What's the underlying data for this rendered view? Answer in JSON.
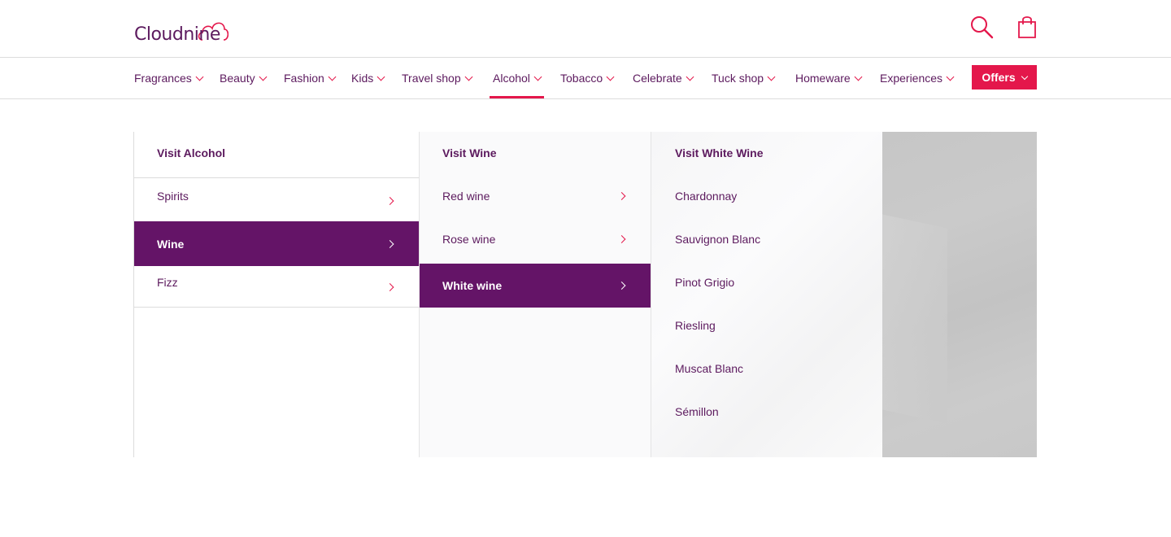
{
  "brand": {
    "name": "Cloudnine"
  },
  "header": {
    "search_icon": "search-icon",
    "bag_icon": "shopping-bag-icon"
  },
  "nav": {
    "items": [
      {
        "label": "Fragrances"
      },
      {
        "label": "Beauty"
      },
      {
        "label": "Fashion"
      },
      {
        "label": "Kids"
      },
      {
        "label": "Travel shop"
      },
      {
        "label": "Alcohol"
      },
      {
        "label": "Tobacco"
      },
      {
        "label": "Celebrate"
      },
      {
        "label": "Tuck shop"
      },
      {
        "label": "Homeware"
      },
      {
        "label": "Experiences"
      }
    ],
    "offers_label": "Offers"
  },
  "mega_menu": {
    "col1": {
      "visit_label": "Visit Alcohol",
      "items": [
        {
          "label": "Spirits"
        },
        {
          "label": "Wine"
        },
        {
          "label": "Fizz"
        }
      ]
    },
    "col2": {
      "visit_label": "Visit Wine",
      "items": [
        {
          "label": "Red wine"
        },
        {
          "label": "Rose wine"
        },
        {
          "label": "White wine"
        }
      ]
    },
    "col3": {
      "visit_label": "Visit White Wine",
      "items": [
        {
          "label": "Chardonnay"
        },
        {
          "label": "Sauvignon Blanc"
        },
        {
          "label": "Pinot Grigio"
        },
        {
          "label": "Riesling"
        },
        {
          "label": "Muscat Blanc"
        },
        {
          "label": "Sémillon"
        }
      ]
    }
  },
  "colors": {
    "brand_purple": "#5c1a5e",
    "accent_red": "#e4174b",
    "selected_bg": "#641467"
  }
}
